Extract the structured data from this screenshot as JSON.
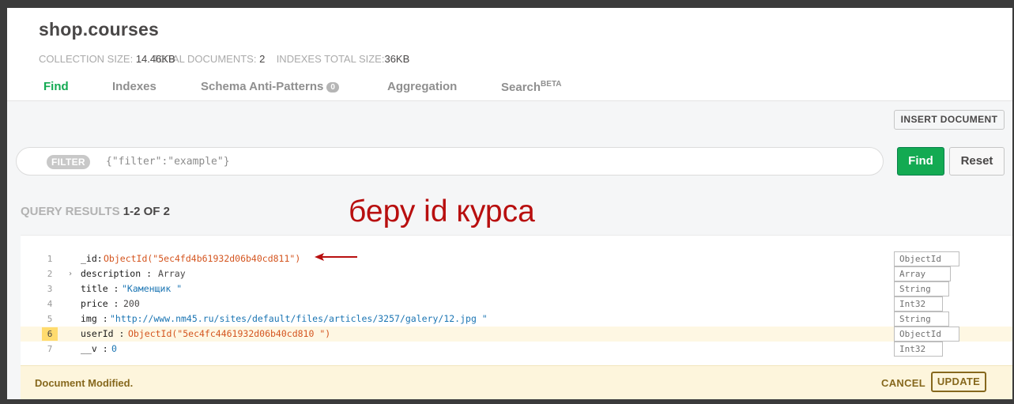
{
  "header": {
    "title": "shop.courses",
    "stats": [
      {
        "label": "COLLECTION SIZE:",
        "value": "14.46KB"
      },
      {
        "label": "TOTAL DOCUMENTS:",
        "value": "2"
      },
      {
        "label": "INDEXES TOTAL SIZE:",
        "value": "36KB"
      }
    ],
    "tabs": [
      {
        "label": "Find",
        "active": true
      },
      {
        "label": "Indexes"
      },
      {
        "label": "Schema Anti-Patterns",
        "badge": "0"
      },
      {
        "label": "Aggregation"
      },
      {
        "label": "Search",
        "sup": "BETA"
      }
    ]
  },
  "toolbar": {
    "insert_label": "INSERT DOCUMENT",
    "filter_label": "FILTER",
    "filter_placeholder": "{\"filter\":\"example\"}",
    "find_label": "Find",
    "reset_label": "Reset"
  },
  "results": {
    "label": "QUERY RESULTS",
    "count": "1-2 OF 2"
  },
  "annotation": {
    "text": "беру id курса",
    "color": "#b80f0f"
  },
  "document": {
    "lines": [
      {
        "n": "1",
        "key": "_id",
        "sep": ":",
        "value": "ObjectId(\"5ec4fd4b61932d06b40cd811\")",
        "kind": "oid",
        "type": "ObjectId"
      },
      {
        "n": "2",
        "key": "description",
        "sep": " :",
        "value": "Array",
        "kind": "plain",
        "type": "Array",
        "expandable": true
      },
      {
        "n": "3",
        "key": "title",
        "sep": " :",
        "value": "\"Каменщик  \"",
        "kind": "str",
        "type": "String"
      },
      {
        "n": "4",
        "key": "price",
        "sep": " :",
        "value": "200",
        "kind": "plain",
        "type": "Int32"
      },
      {
        "n": "5",
        "key": "img",
        "sep": " :",
        "value": "\"http://www.nm45.ru/sites/default/files/articles/3257/galery/12.jpg       \"",
        "kind": "str",
        "type": "String"
      },
      {
        "n": "6",
        "key": "userId",
        "sep": "  :",
        "value": "ObjectId(\"5ec4fc4461932d06b40cd810   \")",
        "kind": "oid",
        "type": "ObjectId",
        "highlight": true
      },
      {
        "n": "7",
        "key": "__v",
        "sep": " :",
        "value": "0",
        "kind": "str",
        "type": "Int32"
      }
    ]
  },
  "footer": {
    "message": "Document Modified.",
    "cancel_label": "CANCEL",
    "update_label": "UPDATE"
  }
}
